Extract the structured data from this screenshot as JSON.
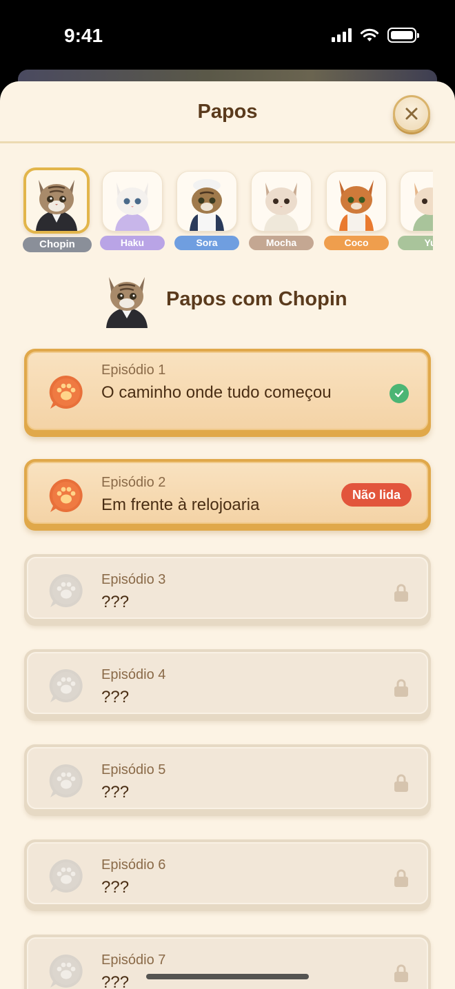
{
  "status": {
    "time": "9:41"
  },
  "sheet": {
    "title": "Papos",
    "close_icon": "close-icon"
  },
  "characters": [
    {
      "name": "Chopin",
      "color": "#8a8f99",
      "selected": true
    },
    {
      "name": "Haku",
      "color": "#b9a4e6",
      "selected": false
    },
    {
      "name": "Sora",
      "color": "#6f9ee0",
      "selected": false
    },
    {
      "name": "Mocha",
      "color": "#c4a792",
      "selected": false
    },
    {
      "name": "Coco",
      "color": "#ef9e4d",
      "selected": false
    },
    {
      "name": "Yu",
      "color": "#a9c49b",
      "selected": false
    }
  ],
  "chat": {
    "title": "Papos com Chopin"
  },
  "episodes": [
    {
      "label": "Episódio 1",
      "title": "O caminho onde tudo começou",
      "state": "read",
      "status_icon": "check-icon"
    },
    {
      "label": "Episódio 2",
      "title": "Em frente à relojoaria",
      "state": "unread",
      "badge": "Não lida"
    },
    {
      "label": "Episódio 3",
      "title": "???",
      "state": "locked",
      "status_icon": "lock-icon"
    },
    {
      "label": "Episódio 4",
      "title": "???",
      "state": "locked",
      "status_icon": "lock-icon"
    },
    {
      "label": "Episódio 5",
      "title": "???",
      "state": "locked",
      "status_icon": "lock-icon"
    },
    {
      "label": "Episódio 6",
      "title": "???",
      "state": "locked",
      "status_icon": "lock-icon"
    },
    {
      "label": "Episódio 7",
      "title": "???",
      "state": "locked",
      "status_icon": "lock-icon"
    }
  ],
  "colors": {
    "accent": "#e0a84a",
    "badge": "#e2553c",
    "check": "#4bb574",
    "sheet_bg": "#fcf3e4"
  }
}
